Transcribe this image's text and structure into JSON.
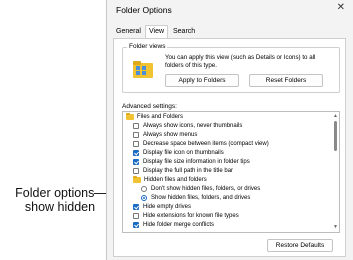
{
  "callout": {
    "line1": "Folder options –",
    "line2": "show hidden"
  },
  "window": {
    "title": "Folder Options",
    "close": "✕"
  },
  "tabs": [
    {
      "label": "General"
    },
    {
      "label": "View"
    },
    {
      "label": "Search"
    }
  ],
  "folder_views": {
    "label": "Folder views",
    "description": "You can apply this view (such as Details or Icons) to all folders of this type.",
    "apply_button": "Apply to Folders",
    "reset_button": "Reset Folders"
  },
  "advanced": {
    "label": "Advanced settings:",
    "items": [
      {
        "kind": "folder",
        "text": "Files and Folders"
      },
      {
        "kind": "checkbox",
        "checked": false,
        "text": "Always show icons, never thumbnails"
      },
      {
        "kind": "checkbox",
        "checked": false,
        "text": "Always show menus"
      },
      {
        "kind": "checkbox",
        "checked": false,
        "text": "Decrease space between items (compact view)"
      },
      {
        "kind": "checkbox",
        "checked": true,
        "text": "Display file icon on thumbnails"
      },
      {
        "kind": "checkbox",
        "checked": true,
        "text": "Display file size information in folder tips"
      },
      {
        "kind": "checkbox",
        "checked": false,
        "text": "Display the full path in the title bar"
      },
      {
        "kind": "folder",
        "text": "Hidden files and folders"
      },
      {
        "kind": "radio",
        "checked": false,
        "text": "Don't show hidden files, folders, or drives"
      },
      {
        "kind": "radio",
        "checked": true,
        "text": "Show hidden files, folders, and drives"
      },
      {
        "kind": "checkbox",
        "checked": true,
        "text": "Hide empty drives"
      },
      {
        "kind": "checkbox",
        "checked": false,
        "text": "Hide extensions for known file types"
      },
      {
        "kind": "checkbox",
        "checked": true,
        "text": "Hide folder merge conflicts"
      }
    ]
  },
  "restore_button": "Restore Defaults",
  "colors": {
    "accent": "#1a6bc4",
    "folder": "#f1c232"
  }
}
